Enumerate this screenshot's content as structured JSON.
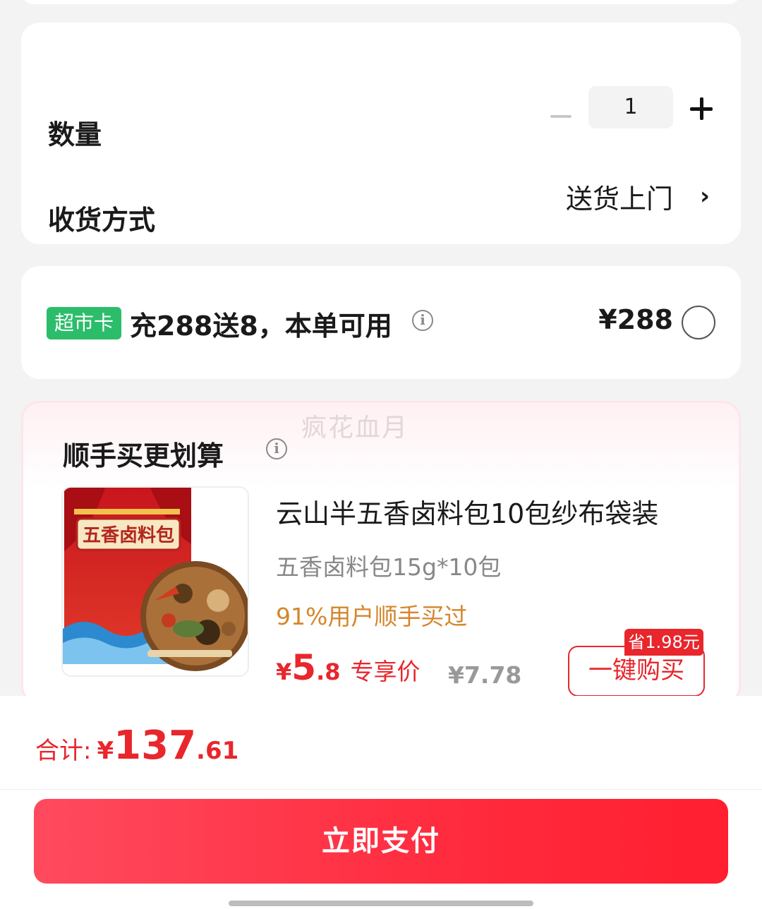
{
  "quantity_section": {
    "qty_label": "数量",
    "qty_value": "1",
    "shipping_label": "收货方式",
    "shipping_value": "送货上门",
    "chevron_glyph": "›"
  },
  "promo": {
    "badge": "超市卡",
    "text": "充288送8，本单可用",
    "price": "¥288"
  },
  "deal": {
    "watermark": "疯花血月",
    "title": "顺手买更划算",
    "product_name": "云山半五香卤料包10包纱布袋装",
    "product_spec": "五香卤料包15g*10包",
    "social_proof": "91%用户顺手买过",
    "price_symbol": "¥",
    "price_int": "5",
    "price_dec": ".8",
    "price_tag": "专享价",
    "original_price": "¥7.78",
    "save_tag": "省1.98元",
    "buy_button": "一键购买",
    "package_text": "五香卤料包"
  },
  "footer": {
    "total_label": "合计:",
    "total_symbol": "¥",
    "total_int": "137",
    "total_dec": ".61",
    "pay_button": "立即支付"
  },
  "colors": {
    "accent_red": "#e8262c",
    "badge_green": "#2cbd6b",
    "social_orange": "#d4862b"
  },
  "icons": [
    "minus-icon",
    "plus-icon",
    "chevron-right-icon",
    "info-icon",
    "radio-icon"
  ]
}
